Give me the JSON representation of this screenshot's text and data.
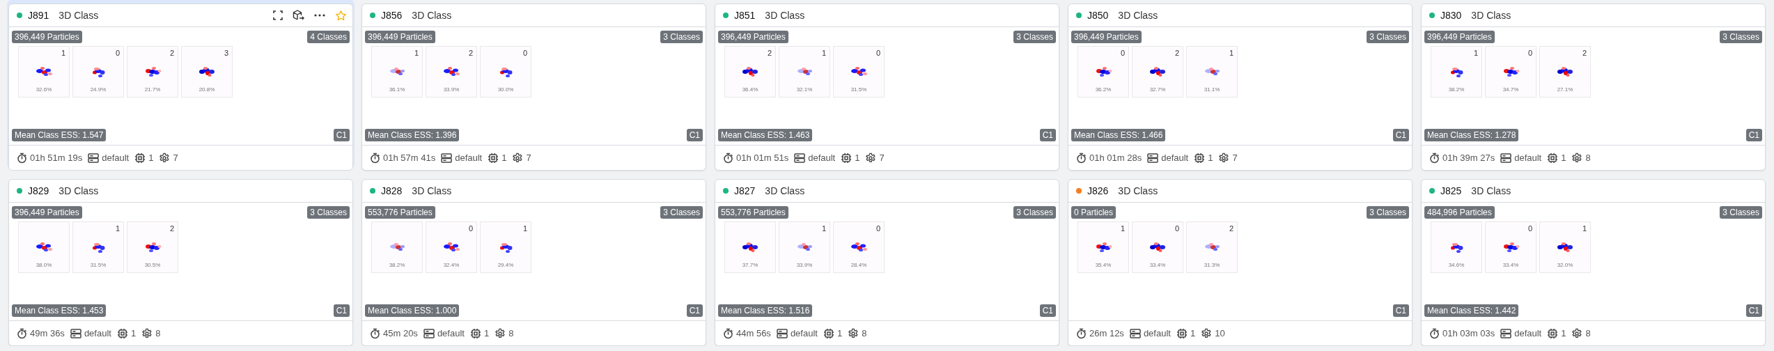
{
  "jobs": [
    {
      "id": "J891",
      "type": "3D Class",
      "color": "#1db585",
      "selected": true,
      "starred": false,
      "particles": "396,449 Particles",
      "classes_count": "4 Classes",
      "classes": [
        {
          "label": "1",
          "percent": "32.6%"
        },
        {
          "label": "0",
          "percent": "24.9%"
        },
        {
          "label": "2",
          "percent": "21.7%"
        },
        {
          "label": "3",
          "percent": "20.8%"
        }
      ],
      "ess": "Mean Class ESS: 1.547",
      "symmetry": "C1",
      "duration": "01h 51m 19s",
      "lane": "default",
      "gpus": "1",
      "cpus": "7"
    },
    {
      "id": "J856",
      "type": "3D Class",
      "color": "#1db585",
      "selected": false,
      "particles": "396,449 Particles",
      "classes_count": "3 Classes",
      "classes": [
        {
          "label": "1",
          "percent": "36.1%"
        },
        {
          "label": "2",
          "percent": "33.9%"
        },
        {
          "label": "0",
          "percent": "30.0%"
        }
      ],
      "ess": "Mean Class ESS: 1.396",
      "symmetry": "C1",
      "duration": "01h 57m 41s",
      "lane": "default",
      "gpus": "1",
      "cpus": "7"
    },
    {
      "id": "J851",
      "type": "3D Class",
      "color": "#1db585",
      "selected": false,
      "particles": "396,449 Particles",
      "classes_count": "3 Classes",
      "classes": [
        {
          "label": "2",
          "percent": "36.4%"
        },
        {
          "label": "1",
          "percent": "32.1%"
        },
        {
          "label": "0",
          "percent": "31.5%"
        }
      ],
      "ess": "Mean Class ESS: 1.463",
      "symmetry": "C1",
      "duration": "01h 01m 51s",
      "lane": "default",
      "gpus": "1",
      "cpus": "7"
    },
    {
      "id": "J850",
      "type": "3D Class",
      "color": "#1db585",
      "selected": false,
      "particles": "396,449 Particles",
      "classes_count": "3 Classes",
      "classes": [
        {
          "label": "0",
          "percent": "36.2%"
        },
        {
          "label": "2",
          "percent": "32.7%"
        },
        {
          "label": "1",
          "percent": "31.1%"
        }
      ],
      "ess": "Mean Class ESS: 1.466",
      "symmetry": "C1",
      "duration": "01h 01m 28s",
      "lane": "default",
      "gpus": "1",
      "cpus": "7"
    },
    {
      "id": "J830",
      "type": "3D Class",
      "color": "#1db585",
      "selected": false,
      "particles": "396,449 Particles",
      "classes_count": "3 Classes",
      "classes": [
        {
          "label": "1",
          "percent": "38.2%"
        },
        {
          "label": "0",
          "percent": "34.7%"
        },
        {
          "label": "2",
          "percent": "27.1%"
        }
      ],
      "ess": "Mean Class ESS: 1.278",
      "symmetry": "C1",
      "duration": "01h 39m 27s",
      "lane": "default",
      "gpus": "1",
      "cpus": "8"
    },
    {
      "id": "J829",
      "type": "3D Class",
      "color": "#1db585",
      "selected": false,
      "particles": "396,449 Particles",
      "classes_count": "3 Classes",
      "classes": [
        {
          "percent": "38.0%"
        },
        {
          "label": "1",
          "percent": "31.5%"
        },
        {
          "label": "2",
          "percent": "30.5%"
        }
      ],
      "ess": "Mean Class ESS: 1.453",
      "symmetry": "C1",
      "duration": "49m 36s",
      "lane": "default",
      "gpus": "1",
      "cpus": "8"
    },
    {
      "id": "J828",
      "type": "3D Class",
      "color": "#1db585",
      "selected": false,
      "particles": "553,776 Particles",
      "classes_count": "3 Classes",
      "classes": [
        {
          "percent": "38.2%"
        },
        {
          "label": "0",
          "percent": "32.4%"
        },
        {
          "label": "1",
          "percent": "29.4%"
        }
      ],
      "ess": "Mean Class ESS: 1.000",
      "symmetry": "C1",
      "duration": "45m 20s",
      "lane": "default",
      "gpus": "1",
      "cpus": "8"
    },
    {
      "id": "J827",
      "type": "3D Class",
      "color": "#1db585",
      "selected": false,
      "particles": "553,776 Particles",
      "classes_count": "3 Classes",
      "classes": [
        {
          "percent": "37.7%"
        },
        {
          "label": "1",
          "percent": "33.9%"
        },
        {
          "label": "0",
          "percent": "28.4%"
        }
      ],
      "ess": "Mean Class ESS: 1.516",
      "symmetry": "C1",
      "duration": "44m 56s",
      "lane": "default",
      "gpus": "1",
      "cpus": "8"
    },
    {
      "id": "J826",
      "type": "3D Class",
      "color": "#f57e20",
      "selected": false,
      "particles": "0 Particles",
      "classes_count": "3 Classes",
      "classes": [
        {
          "label": "1",
          "percent": "35.4%"
        },
        {
          "label": "0",
          "percent": "33.4%"
        },
        {
          "label": "2",
          "percent": "31.3%"
        }
      ],
      "symmetry": "C1",
      "duration": "26m 12s",
      "lane": "default",
      "gpus": "1",
      "cpus": "10"
    },
    {
      "id": "J825",
      "type": "3D Class",
      "color": "#1db585",
      "selected": false,
      "particles": "484,996 Particles",
      "classes_count": "3 Classes",
      "classes": [
        {
          "percent": "34.6%"
        },
        {
          "label": "0",
          "percent": "33.4%"
        },
        {
          "label": "1",
          "percent": "32.0%"
        }
      ],
      "ess": "Mean Class ESS: 1.442",
      "symmetry": "C1",
      "duration": "01h 03m 03s",
      "lane": "default",
      "gpus": "1",
      "cpus": "8"
    }
  ]
}
